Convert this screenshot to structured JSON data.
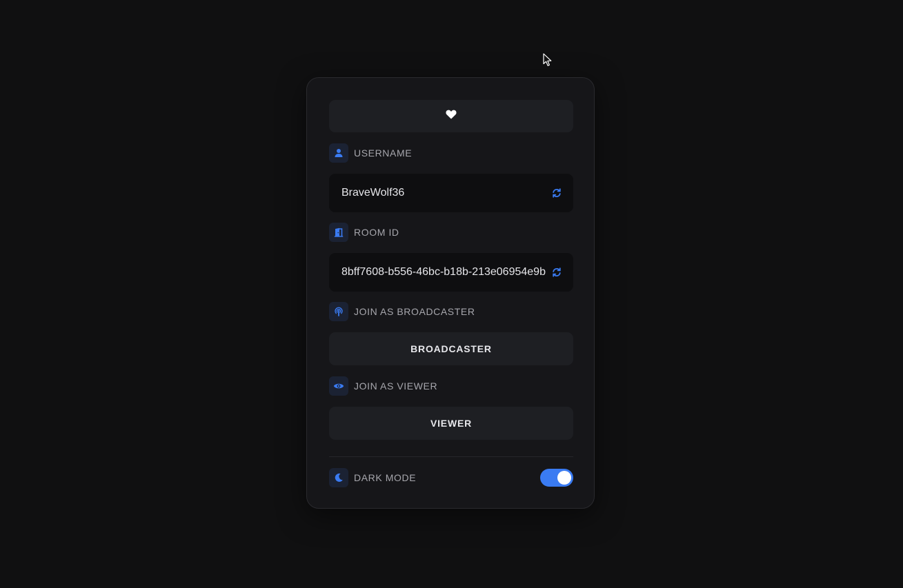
{
  "username_section": {
    "label": "USERNAME",
    "value": "BraveWolf36",
    "label_icon": "user-icon",
    "action_icon": "refresh-icon"
  },
  "room_section": {
    "label": "ROOM ID",
    "value": "8bff7608-b556-46bc-b18b-213e06954e9b",
    "label_icon": "door-icon",
    "action_icon": "refresh-icon"
  },
  "broadcaster_section": {
    "label": "JOIN AS BROADCASTER",
    "button_label": "BROADCASTER",
    "label_icon": "broadcast-icon"
  },
  "viewer_section": {
    "label": "JOIN AS VIEWER",
    "button_label": "VIEWER",
    "label_icon": "eye-icon"
  },
  "dark_mode": {
    "label": "DARK MODE",
    "enabled": true,
    "label_icon": "moon-icon"
  },
  "header_icon": "heart-icon",
  "colors": {
    "accent": "#3a7bf2",
    "background": "#101011",
    "card": "#161619",
    "field": "#0e0e10",
    "button": "#1e1f23"
  }
}
